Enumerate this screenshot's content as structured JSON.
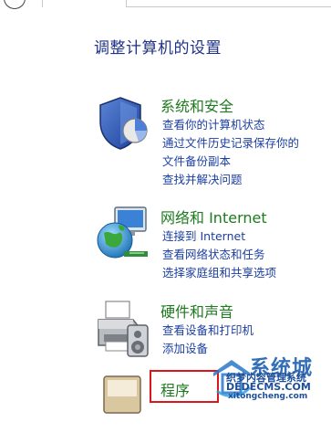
{
  "page": {
    "title": "调整计算机的设置"
  },
  "categories": [
    {
      "title": "系统和安全",
      "icon": "shield-icon",
      "links": [
        "查看你的计算机状态",
        "通过文件历史记录保存你的",
        "文件备份副本",
        "查找并解决问题"
      ]
    },
    {
      "title": "网络和 Internet",
      "icon": "network-globe-icon",
      "links": [
        "连接到 Internet",
        "查看网络状态和任务",
        "选择家庭组和共享选项"
      ]
    },
    {
      "title": "硬件和声音",
      "icon": "printer-icon",
      "links": [
        "查看设备和打印机",
        "添加设备"
      ]
    },
    {
      "title": "程序",
      "icon": "programs-icon",
      "links": []
    }
  ],
  "watermark": {
    "title": "系统城",
    "line1": "织梦内容管理系统",
    "line2": "DEDECMS.COM",
    "line3": "xitongcheng.com"
  },
  "colors": {
    "page_title": "#1e3287",
    "category_title": "#1e7a1e",
    "link": "#1c3fa0",
    "highlight_box": "#d9161c"
  }
}
